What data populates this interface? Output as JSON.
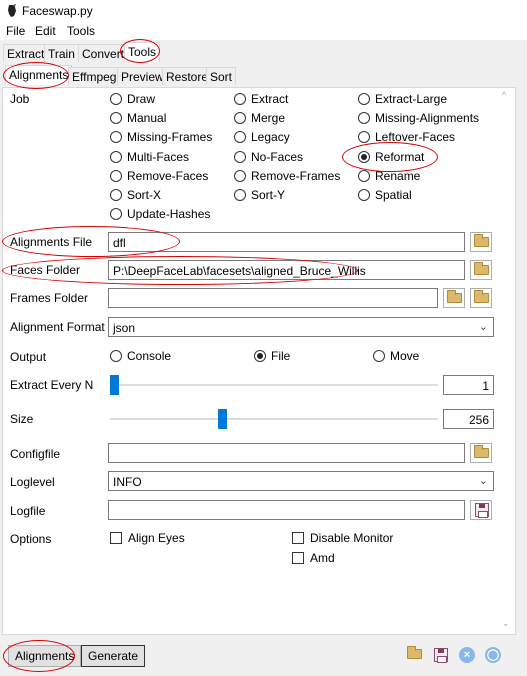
{
  "window": {
    "title": "Faceswap.py"
  },
  "menu": [
    "File",
    "Edit",
    "Tools"
  ],
  "main_tabs": [
    "Extract",
    "Train",
    "Convert",
    "Tools"
  ],
  "tool_tabs": [
    "Alignments",
    "Effmpeg",
    "Preview",
    "Restore",
    "Sort"
  ],
  "job": {
    "label": "Job",
    "selected": "Reformat",
    "options": [
      "Draw",
      "Extract",
      "Extract-Large",
      "Manual",
      "Merge",
      "Missing-Alignments",
      "Missing-Frames",
      "Legacy",
      "Leftover-Faces",
      "Multi-Faces",
      "No-Faces",
      "Reformat",
      "Remove-Faces",
      "Remove-Frames",
      "Rename",
      "Sort-X",
      "Sort-Y",
      "Spatial",
      "Update-Hashes"
    ]
  },
  "alignments_file": {
    "label": "Alignments File",
    "value": "dfl"
  },
  "faces_folder": {
    "label": "Faces Folder",
    "value": "P:\\DeepFaceLab\\facesets\\aligned_Bruce_Willis"
  },
  "frames_folder": {
    "label": "Frames Folder",
    "value": ""
  },
  "alignment_format": {
    "label": "Alignment Format",
    "value": "json"
  },
  "output": {
    "label": "Output",
    "options": [
      "Console",
      "File",
      "Move"
    ],
    "selected": "File"
  },
  "extract_every_n": {
    "label": "Extract Every N",
    "value": "1",
    "level": 0.0
  },
  "size": {
    "label": "Size",
    "value": "256",
    "level": 0.34
  },
  "configfile": {
    "label": "Configfile",
    "value": ""
  },
  "loglevel": {
    "label": "Loglevel",
    "value": "INFO"
  },
  "logfile": {
    "label": "Logfile",
    "value": ""
  },
  "options": {
    "label": "Options",
    "items": [
      "Align Eyes",
      "Disable Monitor",
      "Amd"
    ]
  },
  "bottom": {
    "alignments": "Alignments",
    "generate": "Generate"
  },
  "colors": {
    "accent": "#0078d7",
    "highlight": "#d60000",
    "folder": "#dcb86a"
  }
}
